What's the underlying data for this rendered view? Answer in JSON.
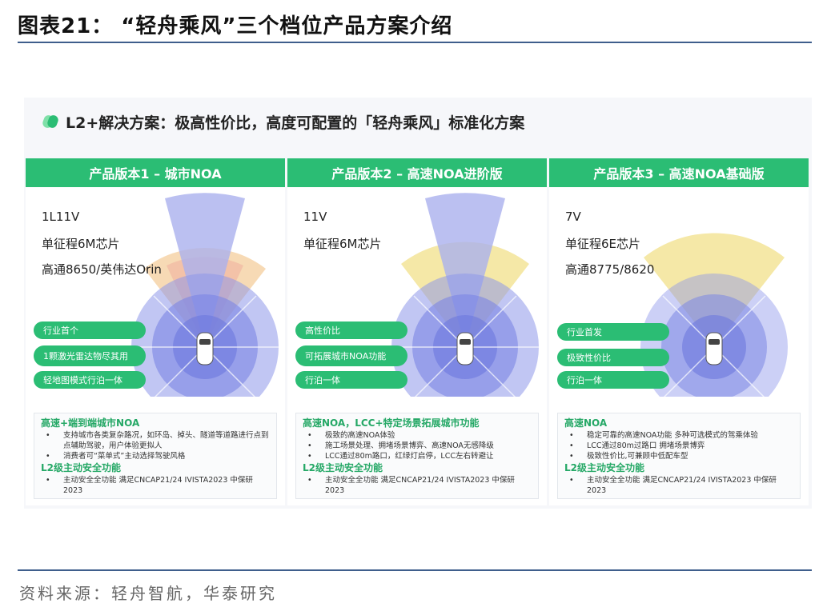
{
  "figure_title": "图表21：  “轻舟乘风”三个档位产品方案介绍",
  "slide_title": "L2+解决方案：极高性价比，高度可配置的「轻舟乘风」标准化方案",
  "source": "资料来源：轻舟智航，华泰研究",
  "colors": {
    "accent_green": "#2bbd74",
    "rule_blue": "#3f5e8c"
  },
  "cards": [
    {
      "header": "产品版本1 – 城市NOA",
      "specs": [
        "1L11V",
        "单征程6M芯片",
        "高通8650/英伟达Orin"
      ],
      "pills": [
        "行业首个",
        "1颗激光雷达物尽其用",
        "轻地图模式行泊一体"
      ],
      "feature_title": "高速+端到端城市NOA",
      "features": [
        "支持城市各类复杂路况，如环岛、掉头、隧道等道路进行点到点辅助驾驶，用户体验更拟人",
        "消费者可“菜单式”主动选择驾驶风格"
      ],
      "safety_title": "L2级主动安全功能",
      "safety": [
        "主动安全全功能 满足CNCAP21/24 IVISTA2023 中保研2023"
      ]
    },
    {
      "header": "产品版本2 – 高速NOA进阶版",
      "specs": [
        "11V",
        "单征程6M芯片"
      ],
      "pills": [
        "高性价比",
        "可拓展城市NOA功能",
        "行泊一体"
      ],
      "feature_title": "高速NOA，LCC+特定场景拓展城市功能",
      "features": [
        "极致的高速NOA体验",
        "施工场景处理、拥堵场景博弈、高速NOA无感降级",
        "LCC通过80m路口，红绿灯启停，LCC左右转避让"
      ],
      "safety_title": "L2级主动安全功能",
      "safety": [
        "主动安全全功能 满足CNCAP21/24 IVISTA2023 中保研2023"
      ]
    },
    {
      "header": "产品版本3 – 高速NOA基础版",
      "specs": [
        "7V",
        "单征程6E芯片",
        "高通8775/8620"
      ],
      "pills": [
        "行业首发",
        "极致性价比",
        "行泊一体"
      ],
      "feature_title": "高速NOA",
      "features": [
        "稳定可靠的高速NOA功能 多种可选模式的驾乘体验",
        "LCC通过80m过路口 拥堵场景博弈",
        "极致性价比,可兼顾中低配车型"
      ],
      "safety_title": "L2级主动安全功能",
      "safety": [
        "主动安全全功能 满足CNCAP21/24 IVISTA2023 中保研2023"
      ]
    }
  ]
}
